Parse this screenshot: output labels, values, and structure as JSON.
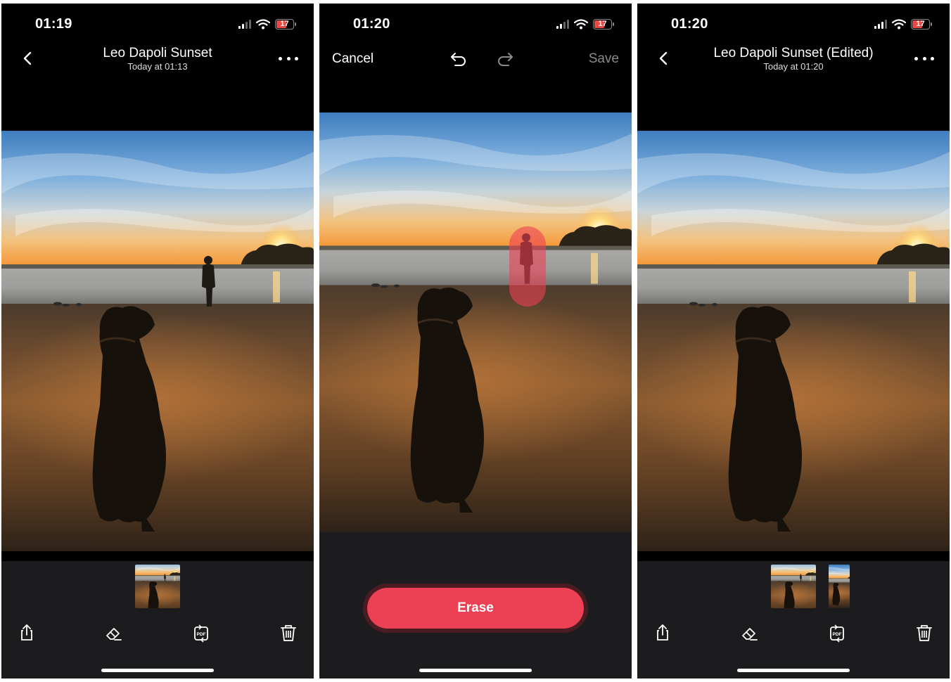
{
  "screen1": {
    "time": "01:19",
    "battery": "17",
    "title": "Leo Dapoli Sunset",
    "subtitle": "Today at 01:13"
  },
  "screen2": {
    "time": "01:20",
    "battery": "17",
    "cancel_label": "Cancel",
    "save_label": "Save",
    "erase_label": "Erase"
  },
  "screen3": {
    "time": "01:20",
    "battery": "17",
    "title": "Leo Dapoli Sunset (Edited)",
    "subtitle": "Today at 01:20"
  },
  "colors": {
    "accent_red": "#ec4154",
    "battery_red": "#e84a43",
    "bar_bg": "#1c1c1e"
  }
}
